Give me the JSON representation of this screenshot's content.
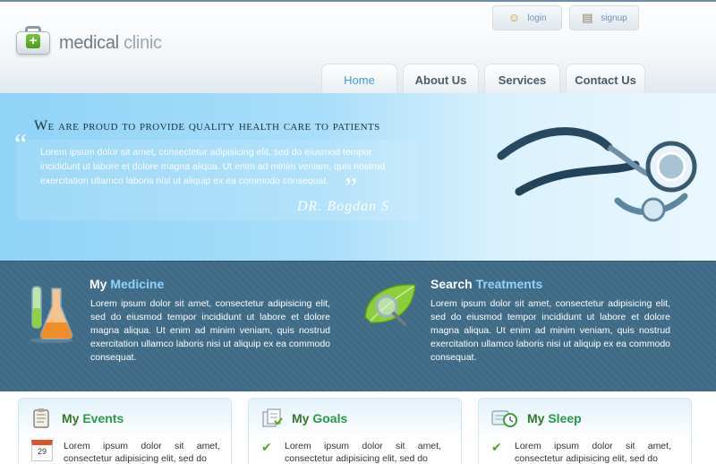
{
  "header": {
    "logo_main": "medical",
    "logo_accent": "clinic",
    "top_links": [
      {
        "label": "login",
        "icon": "user-icon"
      },
      {
        "label": "signup",
        "icon": "clipboard-icon"
      }
    ],
    "nav": [
      "Home",
      "About Us",
      "Services",
      "Contact Us"
    ],
    "active_nav": "Home"
  },
  "banner": {
    "title": "We are proud to provide quality health care to patients",
    "quote": "Lorem ipsum dolor sit amet, consectetur adipisicing elit, sed do eiusmod tempor incididunt ut labore et dolore magna aliqua. Ut enim ad minim veniam, quis nostrud exercitation ullamco laboris nisi ut aliquip ex ea commodo consequat.",
    "signature": "DR. Bogdan S"
  },
  "features": [
    {
      "title_a": "My",
      "title_b": "Medicine",
      "icon": "flask-icon",
      "text": "Lorem ipsum dolor sit amet, consectetur adipisicing elit, sed do eiusmod tempor incididunt ut labore et dolore magna aliqua. Ut enim ad minim veniam, quis nostrud exercitation ullamco laboris nisi ut aliquip ex ea commodo consequat."
    },
    {
      "title_a": "Search",
      "title_b": "Treatments",
      "icon": "leaf-magnifier-icon",
      "text": "Lorem ipsum dolor sit amet, consectetur adipisicing elit, sed do eiusmod tempor incididunt ut labore et dolore magna aliqua. Ut enim ad minim veniam, quis nostrud exercitation ullamco laboris nisi ut aliquip ex ea commodo consequat."
    }
  ],
  "boxes": [
    {
      "title_a": "My",
      "title_b": "Events",
      "icon": "notepad-icon",
      "bullet": "calendar-icon",
      "calendar_day": "29",
      "text": "Lorem ipsum dolor sit amet, consectetur adipisicing elit, sed do"
    },
    {
      "title_a": "My",
      "title_b": "Goals",
      "icon": "documents-icon",
      "bullet": "check-icon",
      "text": "Lorem ipsum dolor sit amet, consectetur adipisicing elit, sed do"
    },
    {
      "title_a": "My",
      "title_b": "Sleep",
      "icon": "clock-icon",
      "bullet": "check-icon",
      "text": "Lorem ipsum dolor sit amet, consectetur adipisicing elit, sed do"
    }
  ]
}
